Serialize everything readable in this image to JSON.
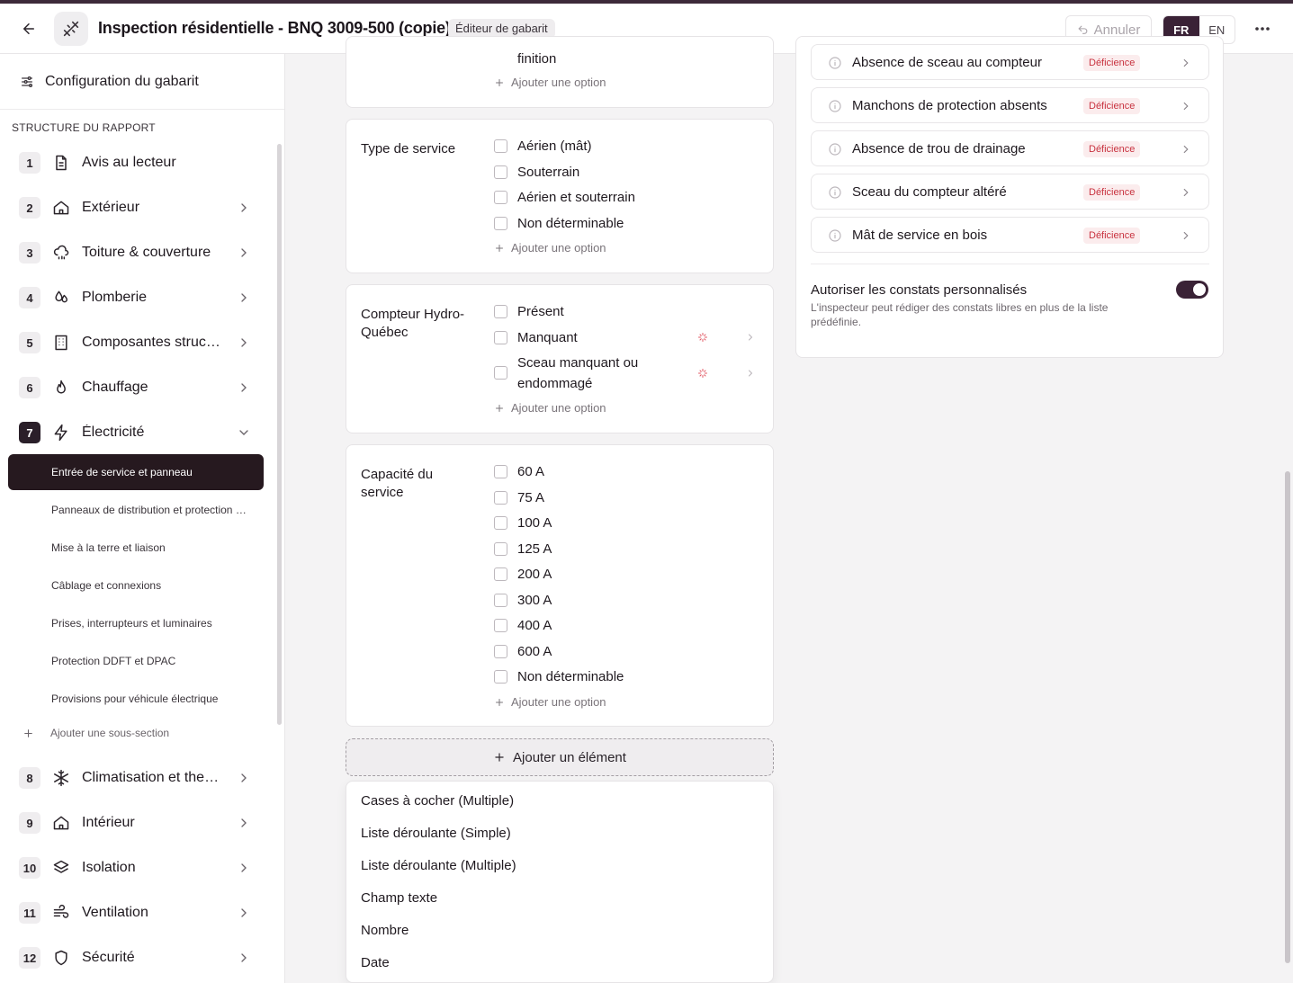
{
  "header": {
    "title": "Inspection résidentielle - BNQ 3009-500 (copie)",
    "badge": "Éditeur de gabarit",
    "undo_label": "Annuler",
    "lang_fr": "FR",
    "lang_en": "EN",
    "active_lang": "FR",
    "icons": [
      "arrow-left-icon",
      "logo-icon",
      "undo-icon",
      "more-horizontal-icon"
    ]
  },
  "sidebar": {
    "config_label": "Configuration du gabarit",
    "structure_label": "STRUCTURE DU RAPPORT",
    "sections": [
      {
        "num": "1",
        "label": "Avis au lecteur",
        "icon": "document-icon",
        "expandable": false
      },
      {
        "num": "2",
        "label": "Extérieur",
        "icon": "house-icon",
        "expandable": true
      },
      {
        "num": "3",
        "label": "Toiture & couverture",
        "icon": "cloud-rain-icon",
        "expandable": true
      },
      {
        "num": "4",
        "label": "Plomberie",
        "icon": "droplets-icon",
        "expandable": true
      },
      {
        "num": "5",
        "label": "Composantes structurales",
        "icon": "building-icon",
        "expandable": true
      },
      {
        "num": "6",
        "label": "Chauffage",
        "icon": "flame-icon",
        "expandable": true
      },
      {
        "num": "7",
        "label": "Électricité",
        "icon": "zap-icon",
        "expanded": true
      },
      {
        "num": "8",
        "label": "Climatisation et thermopompes",
        "icon": "snowflake-icon",
        "expandable": true
      },
      {
        "num": "9",
        "label": "Intérieur",
        "icon": "house-icon",
        "expandable": true
      },
      {
        "num": "10",
        "label": "Isolation",
        "icon": "layers-icon",
        "expandable": true
      },
      {
        "num": "11",
        "label": "Ventilation",
        "icon": "wind-icon",
        "expandable": true
      },
      {
        "num": "12",
        "label": "Sécurité",
        "icon": "shield-icon",
        "expandable": true
      }
    ],
    "subsections": [
      {
        "label": "Entrée de service et panneau",
        "active": true
      },
      {
        "label": "Panneaux de distribution et protection contre les surintensités"
      },
      {
        "label": "Mise à la terre et liaison"
      },
      {
        "label": "Câblage et connexions"
      },
      {
        "label": "Prises, interrupteurs et luminaires"
      },
      {
        "label": "Protection DDFT et DPAC"
      },
      {
        "label": "Provisions pour véhicule électrique"
      }
    ],
    "add_subsection": "Ajouter une sous-section"
  },
  "main": {
    "top_partial": {
      "option_tail": "finition",
      "add_option": "Ajouter une option"
    },
    "fields": [
      {
        "label": "Type de service",
        "options": [
          "Aérien (mât)",
          "Souterrain",
          "Aérien et souterrain",
          "Non déterminable"
        ],
        "add_option": "Ajouter une option"
      },
      {
        "label": "Compteur Hydro-Québec",
        "options": [
          "Présent",
          "Manquant",
          "Sceau manquant ou endommagé"
        ],
        "add_option": "Ajouter une option"
      },
      {
        "label": "Capacité du service",
        "options": [
          "60 A",
          "75 A",
          "100 A",
          "125 A",
          "200 A",
          "300 A",
          "400 A",
          "600 A",
          "Non déterminable"
        ],
        "add_option": "Ajouter une option"
      }
    ],
    "add_element": "Ajouter un élément",
    "element_types": [
      "Cases à cocher (Multiple)",
      "Liste déroulante (Simple)",
      "Liste déroulante (Multiple)",
      "Champ texte",
      "Nombre",
      "Date"
    ]
  },
  "findings": {
    "items": [
      {
        "label": "Absence de sceau au compteur",
        "severity": "Déficience"
      },
      {
        "label": "Manchons de protection absents",
        "severity": "Déficience"
      },
      {
        "label": "Absence de trou de drainage",
        "severity": "Déficience"
      },
      {
        "label": "Sceau du compteur altéré",
        "severity": "Déficience"
      },
      {
        "label": "Mât de service en bois",
        "severity": "Déficience"
      }
    ],
    "custom_title": "Autoriser les constats personnalisés",
    "custom_desc": "L'inspecteur peut rédiger des constats libres en plus de la liste prédéfinie.",
    "custom_enabled": true
  },
  "colors": {
    "accent": "#3a2236",
    "deficiency_text": "#c8323f",
    "deficiency_bg": "#fbeced"
  }
}
